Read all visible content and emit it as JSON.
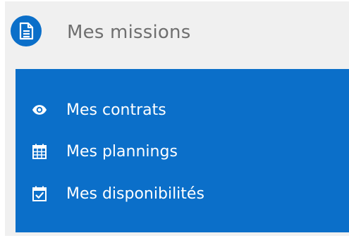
{
  "header": {
    "title": "Mes missions",
    "icon": "document-icon"
  },
  "submenu": {
    "items": [
      {
        "label": "Mes contrats",
        "icon": "eye-icon"
      },
      {
        "label": "Mes plannings",
        "icon": "calendar-grid-icon"
      },
      {
        "label": "Mes disponibilités",
        "icon": "calendar-check-icon"
      }
    ]
  },
  "colors": {
    "accent": "#0b6fc9",
    "header_bg": "#f0f0f0",
    "header_text": "#6f6f6f",
    "submenu_text": "#ffffff"
  }
}
